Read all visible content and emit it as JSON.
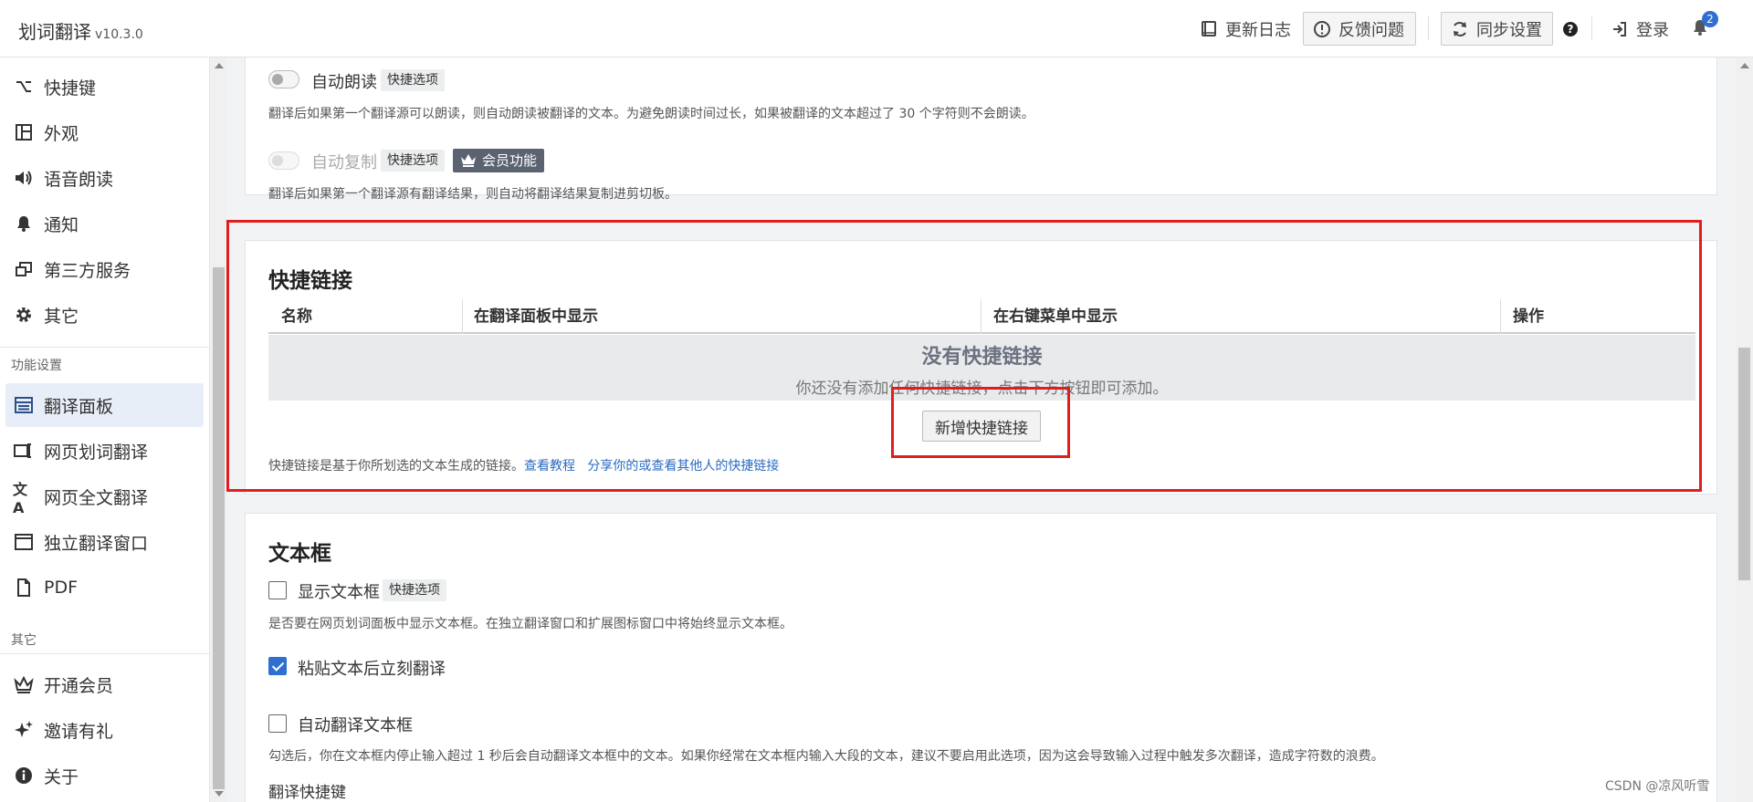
{
  "header": {
    "app_name": "划词翻译",
    "version": "v10.3.0",
    "changelog": "更新日志",
    "feedback": "反馈问题",
    "sync": "同步设置",
    "help": "?",
    "login": "登录",
    "notification_count": "2"
  },
  "sidebar": {
    "items_top": [
      {
        "label": "快捷键",
        "icon": "option-key-icon"
      },
      {
        "label": "外观",
        "icon": "layout-icon"
      },
      {
        "label": "语音朗读",
        "icon": "speaker-icon"
      },
      {
        "label": "通知",
        "icon": "bell-icon"
      },
      {
        "label": "第三方服务",
        "icon": "windows-icon"
      },
      {
        "label": "其它",
        "icon": "gear-icon"
      }
    ],
    "group_feature": "功能设置",
    "items_feature": [
      {
        "label": "翻译面板",
        "icon": "panel-icon"
      },
      {
        "label": "网页划词翻译",
        "icon": "select-translate-icon"
      },
      {
        "label": "网页全文翻译",
        "icon": "translate-icon"
      },
      {
        "label": "独立翻译窗口",
        "icon": "window-icon"
      },
      {
        "label": "PDF",
        "icon": "file-icon"
      }
    ],
    "group_other": "其它",
    "items_other": [
      {
        "label": "开通会员",
        "icon": "crown-icon"
      },
      {
        "label": "邀请有礼",
        "icon": "sparkle-icon"
      },
      {
        "label": "关于",
        "icon": "info-icon"
      }
    ]
  },
  "options": {
    "auto_read": {
      "label": "自动朗读",
      "tag": "快捷选项",
      "desc": "翻译后如果第一个翻译源可以朗读，则自动朗读被翻译的文本。为避免朗读时间过长，如果被翻译的文本超过了 30 个字符则不会朗读。"
    },
    "auto_copy": {
      "label": "自动复制",
      "tag": "快捷选项",
      "member_tag": "会员功能",
      "desc": "翻译后如果第一个翻译源有翻译结果，则自动将翻译结果复制进剪切板。"
    }
  },
  "quick_links": {
    "title": "快捷链接",
    "columns": [
      "名称",
      "在翻译面板中显示",
      "在右键菜单中显示",
      "操作"
    ],
    "empty_title": "没有快捷链接",
    "empty_sub": "你还没有添加任何快捷链接，点击下方按钮即可添加。",
    "add_button": "新增快捷链接",
    "footer_text": "快捷链接是基于你所划选的文本生成的链接。",
    "link_tutorial": "查看教程",
    "link_share": "分享你的或查看其他人的快捷链接"
  },
  "textbox": {
    "title": "文本框",
    "show": {
      "label": "显示文本框",
      "tag": "快捷选项",
      "checked": false,
      "desc": "是否要在网页划词面板中显示文本框。在独立翻译窗口和扩展图标窗口中将始终显示文本框。"
    },
    "paste": {
      "label": "粘贴文本后立刻翻译",
      "checked": true
    },
    "auto": {
      "label": "自动翻译文本框",
      "checked": false,
      "desc": "勾选后，你在文本框内停止输入超过 1 秒后会自动翻译文本框中的文本。如果你经常在文本框内输入大段的文本，建议不要启用此选项，因为这会导致输入过程中触发多次翻译，造成字符数的浪费。"
    },
    "shortcut_label": "翻译快捷键"
  },
  "watermark": "CSDN @凉风听雪",
  "colors": {
    "accent": "#2f6fd1",
    "highlight": "#e01e1e",
    "member_tag": "#5b6370"
  }
}
